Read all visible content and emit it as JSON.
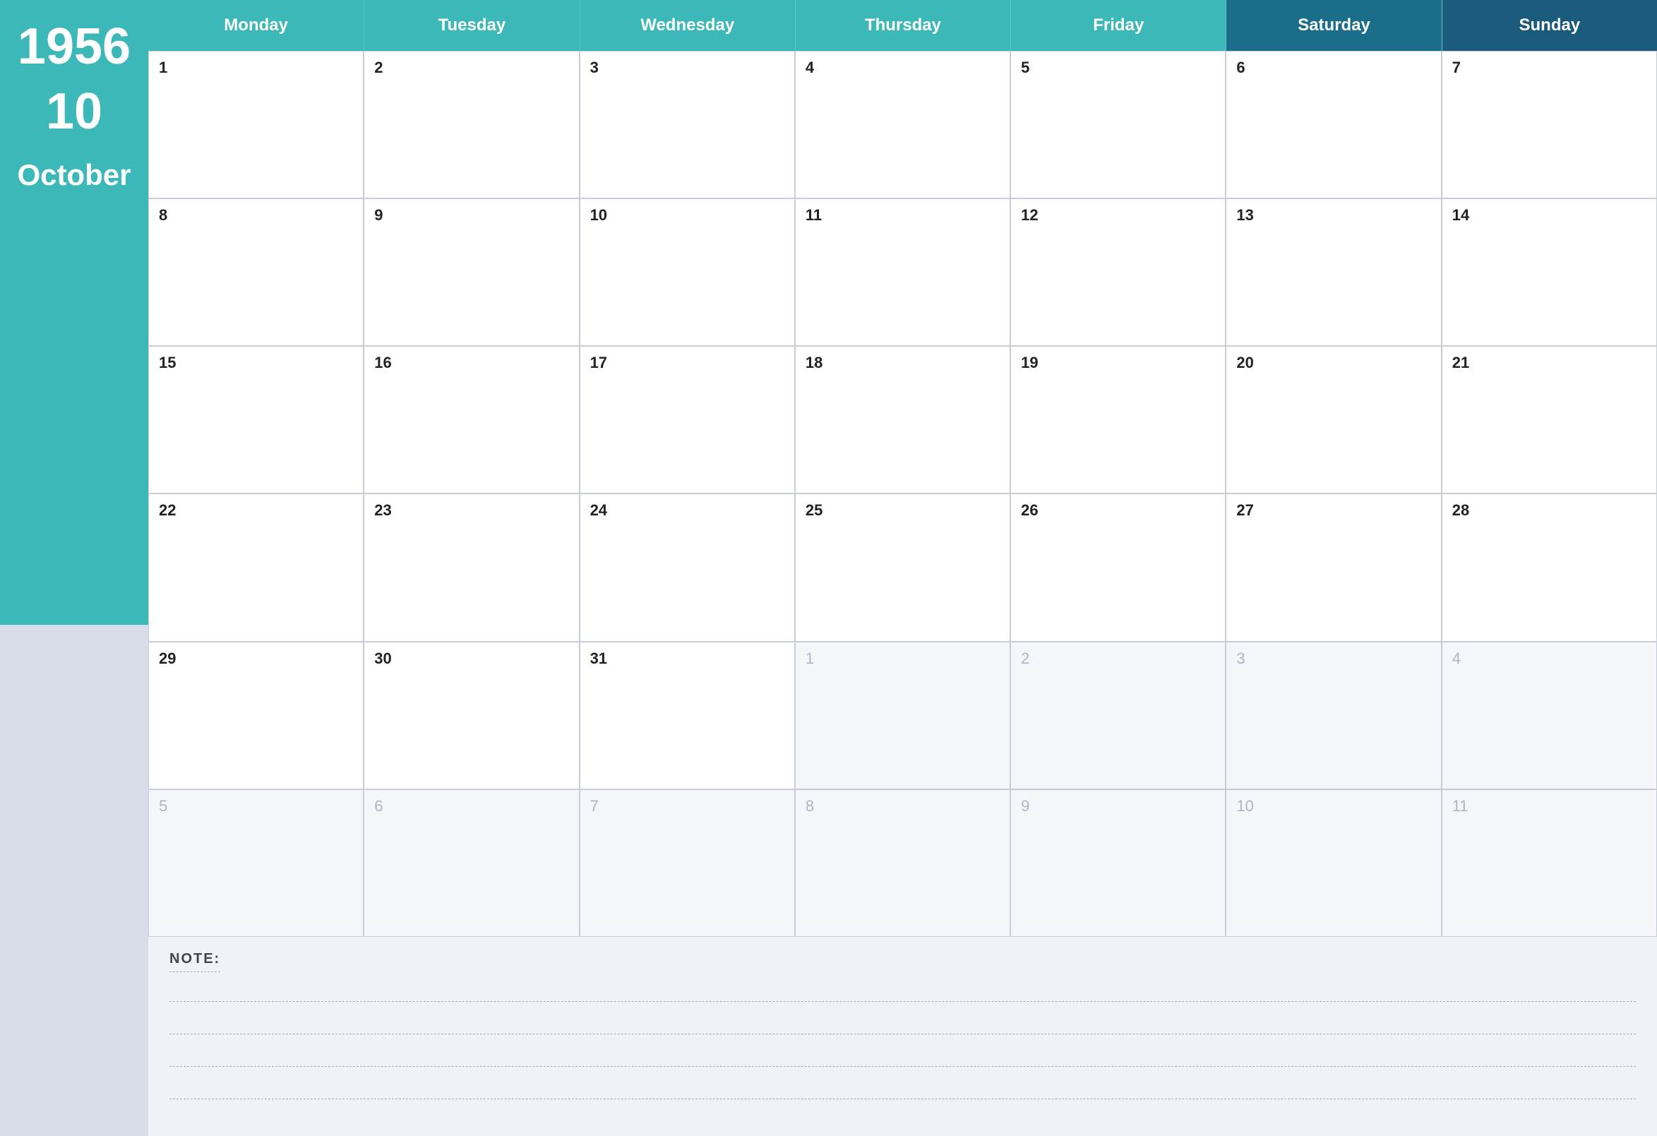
{
  "sidebar": {
    "year": "1956",
    "week_number": "10",
    "month": "October"
  },
  "header": {
    "days": [
      {
        "id": "monday",
        "label": "Monday",
        "class": ""
      },
      {
        "id": "tuesday",
        "label": "Tuesday",
        "class": ""
      },
      {
        "id": "wednesday",
        "label": "Wednesday",
        "class": ""
      },
      {
        "id": "thursday",
        "label": "Thursday",
        "class": ""
      },
      {
        "id": "friday",
        "label": "Friday",
        "class": ""
      },
      {
        "id": "saturday",
        "label": "Saturday",
        "class": "saturday"
      },
      {
        "id": "sunday",
        "label": "Sunday",
        "class": "sunday"
      }
    ]
  },
  "calendar_rows": [
    [
      {
        "day": "1",
        "other": false
      },
      {
        "day": "2",
        "other": false
      },
      {
        "day": "3",
        "other": false
      },
      {
        "day": "4",
        "other": false
      },
      {
        "day": "5",
        "other": false
      },
      {
        "day": "6",
        "other": false
      },
      {
        "day": "7",
        "other": false
      }
    ],
    [
      {
        "day": "8",
        "other": false
      },
      {
        "day": "9",
        "other": false
      },
      {
        "day": "10",
        "other": false
      },
      {
        "day": "11",
        "other": false
      },
      {
        "day": "12",
        "other": false
      },
      {
        "day": "13",
        "other": false
      },
      {
        "day": "14",
        "other": false
      }
    ],
    [
      {
        "day": "15",
        "other": false
      },
      {
        "day": "16",
        "other": false
      },
      {
        "day": "17",
        "other": false
      },
      {
        "day": "18",
        "other": false
      },
      {
        "day": "19",
        "other": false
      },
      {
        "day": "20",
        "other": false
      },
      {
        "day": "21",
        "other": false
      }
    ],
    [
      {
        "day": "22",
        "other": false
      },
      {
        "day": "23",
        "other": false
      },
      {
        "day": "24",
        "other": false
      },
      {
        "day": "25",
        "other": false
      },
      {
        "day": "26",
        "other": false
      },
      {
        "day": "27",
        "other": false
      },
      {
        "day": "28",
        "other": false
      }
    ],
    [
      {
        "day": "29",
        "other": false
      },
      {
        "day": "30",
        "other": false
      },
      {
        "day": "31",
        "other": false
      },
      {
        "day": "1",
        "other": true
      },
      {
        "day": "2",
        "other": true
      },
      {
        "day": "3",
        "other": true
      },
      {
        "day": "4",
        "other": true
      }
    ],
    [
      {
        "day": "5",
        "other": true
      },
      {
        "day": "6",
        "other": true
      },
      {
        "day": "7",
        "other": true
      },
      {
        "day": "8",
        "other": true
      },
      {
        "day": "9",
        "other": true
      },
      {
        "day": "10",
        "other": true
      },
      {
        "day": "11",
        "other": true
      }
    ]
  ],
  "notes": {
    "label": "NOTE:",
    "lines": 4
  }
}
